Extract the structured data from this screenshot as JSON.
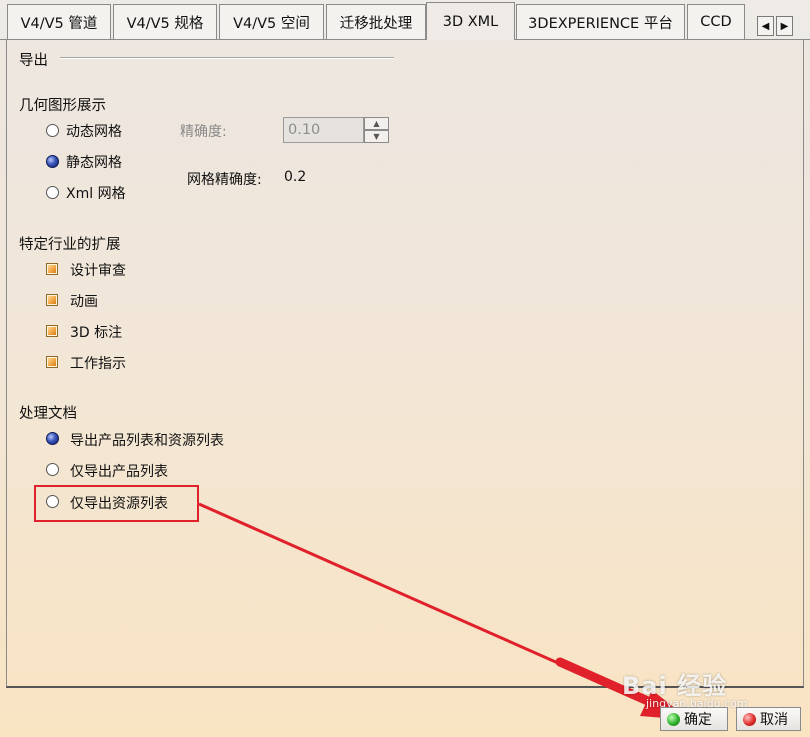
{
  "tabs": [
    {
      "label": "V4/V5 管道"
    },
    {
      "label": "V4/V5 规格"
    },
    {
      "label": "V4/V5 空间"
    },
    {
      "label": "迁移批处理"
    },
    {
      "label": "3D XML"
    },
    {
      "label": "3DEXPERIENCE 平台"
    },
    {
      "label": "CCD"
    }
  ],
  "active_tab": "3D XML",
  "export": {
    "title": "导出",
    "geometry": {
      "title": "几何图形展示",
      "options": [
        {
          "label": "动态网格",
          "checked": false
        },
        {
          "label": "静态网格",
          "checked": true
        },
        {
          "label": "Xml 网格",
          "checked": false
        }
      ],
      "precision_label": "精确度:",
      "precision_value": "0.10",
      "mesh_precision_label": "网格精确度:",
      "mesh_precision_value": "0.2"
    },
    "industry": {
      "title": "特定行业的扩展",
      "items": [
        {
          "label": "设计审查",
          "checked": true
        },
        {
          "label": "动画",
          "checked": true
        },
        {
          "label": "3D 标注",
          "checked": true
        },
        {
          "label": "工作指示",
          "checked": true
        }
      ]
    },
    "documents": {
      "title": "处理文档",
      "options": [
        {
          "label": "导出产品列表和资源列表",
          "checked": true
        },
        {
          "label": "仅导出产品列表",
          "checked": false
        },
        {
          "label": "仅导出资源列表",
          "checked": false
        }
      ]
    }
  },
  "buttons": {
    "ok": "确定",
    "cancel": "取消"
  },
  "watermark": {
    "text": "Bai 经验",
    "url": "jingyan.baidu.com"
  },
  "colors": {
    "annotation": "#e0202a"
  }
}
